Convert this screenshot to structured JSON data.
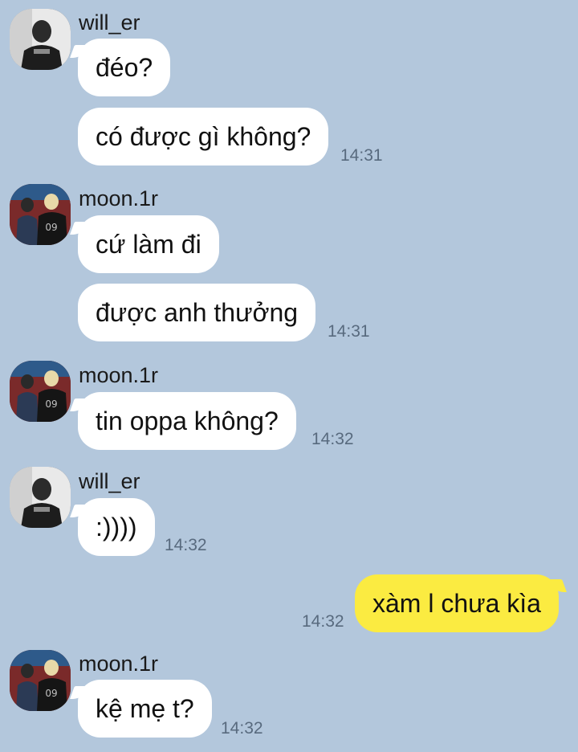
{
  "chat": {
    "groups": [
      {
        "sender": "will_er",
        "avatar_icon": "user-avatar-will-icon",
        "messages": [
          {
            "text": "đéo?",
            "time": ""
          },
          {
            "text": "có được gì không?",
            "time": "14:31"
          }
        ]
      },
      {
        "sender": "moon.1r",
        "avatar_icon": "user-avatar-moon-icon",
        "messages": [
          {
            "text": "cứ làm đi",
            "time": ""
          },
          {
            "text": "được anh thưởng",
            "time": "14:31"
          }
        ]
      },
      {
        "sender": "moon.1r",
        "avatar_icon": "user-avatar-moon-icon",
        "messages": [
          {
            "text": "tin oppa không?",
            "time": "14:32"
          }
        ]
      },
      {
        "sender": "will_er",
        "avatar_icon": "user-avatar-will-icon",
        "messages": [
          {
            "text": ":))))",
            "time": "14:32"
          }
        ]
      },
      {
        "sender": "me",
        "messages": [
          {
            "text": "xàm l chưa kìa",
            "time": "14:32"
          }
        ]
      },
      {
        "sender": "moon.1r",
        "avatar_icon": "user-avatar-moon-icon",
        "messages": [
          {
            "text": "kệ mẹ t?",
            "time": "14:32"
          }
        ]
      }
    ]
  },
  "colors": {
    "background": "#b3c7dc",
    "incoming_bubble": "#ffffff",
    "outgoing_bubble": "#fbeb41",
    "timestamp": "#586a7e"
  }
}
